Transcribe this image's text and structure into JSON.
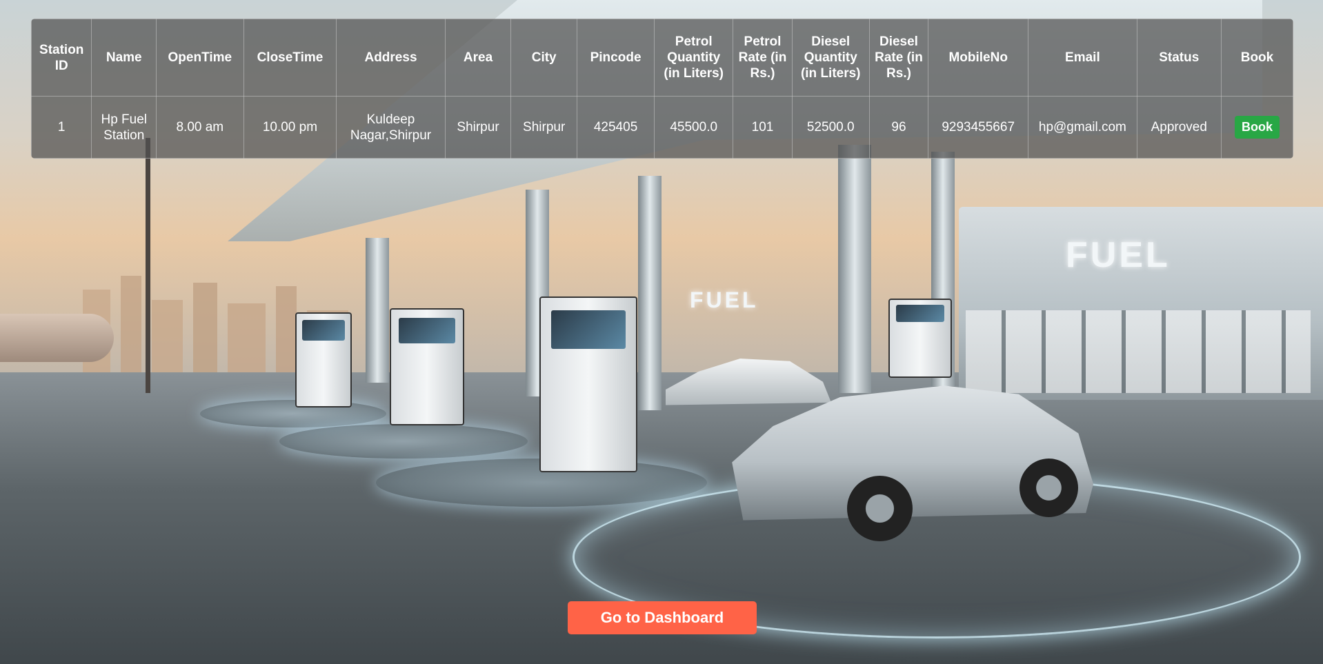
{
  "table": {
    "headers": [
      "Station ID",
      "Name",
      "OpenTime",
      "CloseTime",
      "Address",
      "Area",
      "City",
      "Pincode",
      "Petrol Quantity (in Liters)",
      "Petrol Rate (in Rs.)",
      "Diesel Quantity (in Liters)",
      "Diesel Rate (in Rs.)",
      "MobileNo",
      "Email",
      "Status",
      "Book"
    ],
    "rows": [
      {
        "station_id": "1",
        "name": "Hp Fuel Station",
        "open_time": "8.00 am",
        "close_time": "10.00 pm",
        "address": "Kuldeep Nagar,Shirpur",
        "area": "Shirpur",
        "city": "Shirpur",
        "pincode": "425405",
        "petrol_quantity": "45500.0",
        "petrol_rate": "101",
        "diesel_quantity": "52500.0",
        "diesel_rate": "96",
        "mobile": "9293455667",
        "email": "hp@gmail.com",
        "status": "Approved",
        "book_label": "Book"
      }
    ]
  },
  "dashboard_button": {
    "label": "Go to Dashboard"
  },
  "background": {
    "signs": [
      "FUEL",
      "FUEL"
    ]
  },
  "colors": {
    "book_button": "#28a745",
    "dashboard_button": "#ff6347",
    "table_bg": "rgba(80,80,80,0.72)"
  }
}
